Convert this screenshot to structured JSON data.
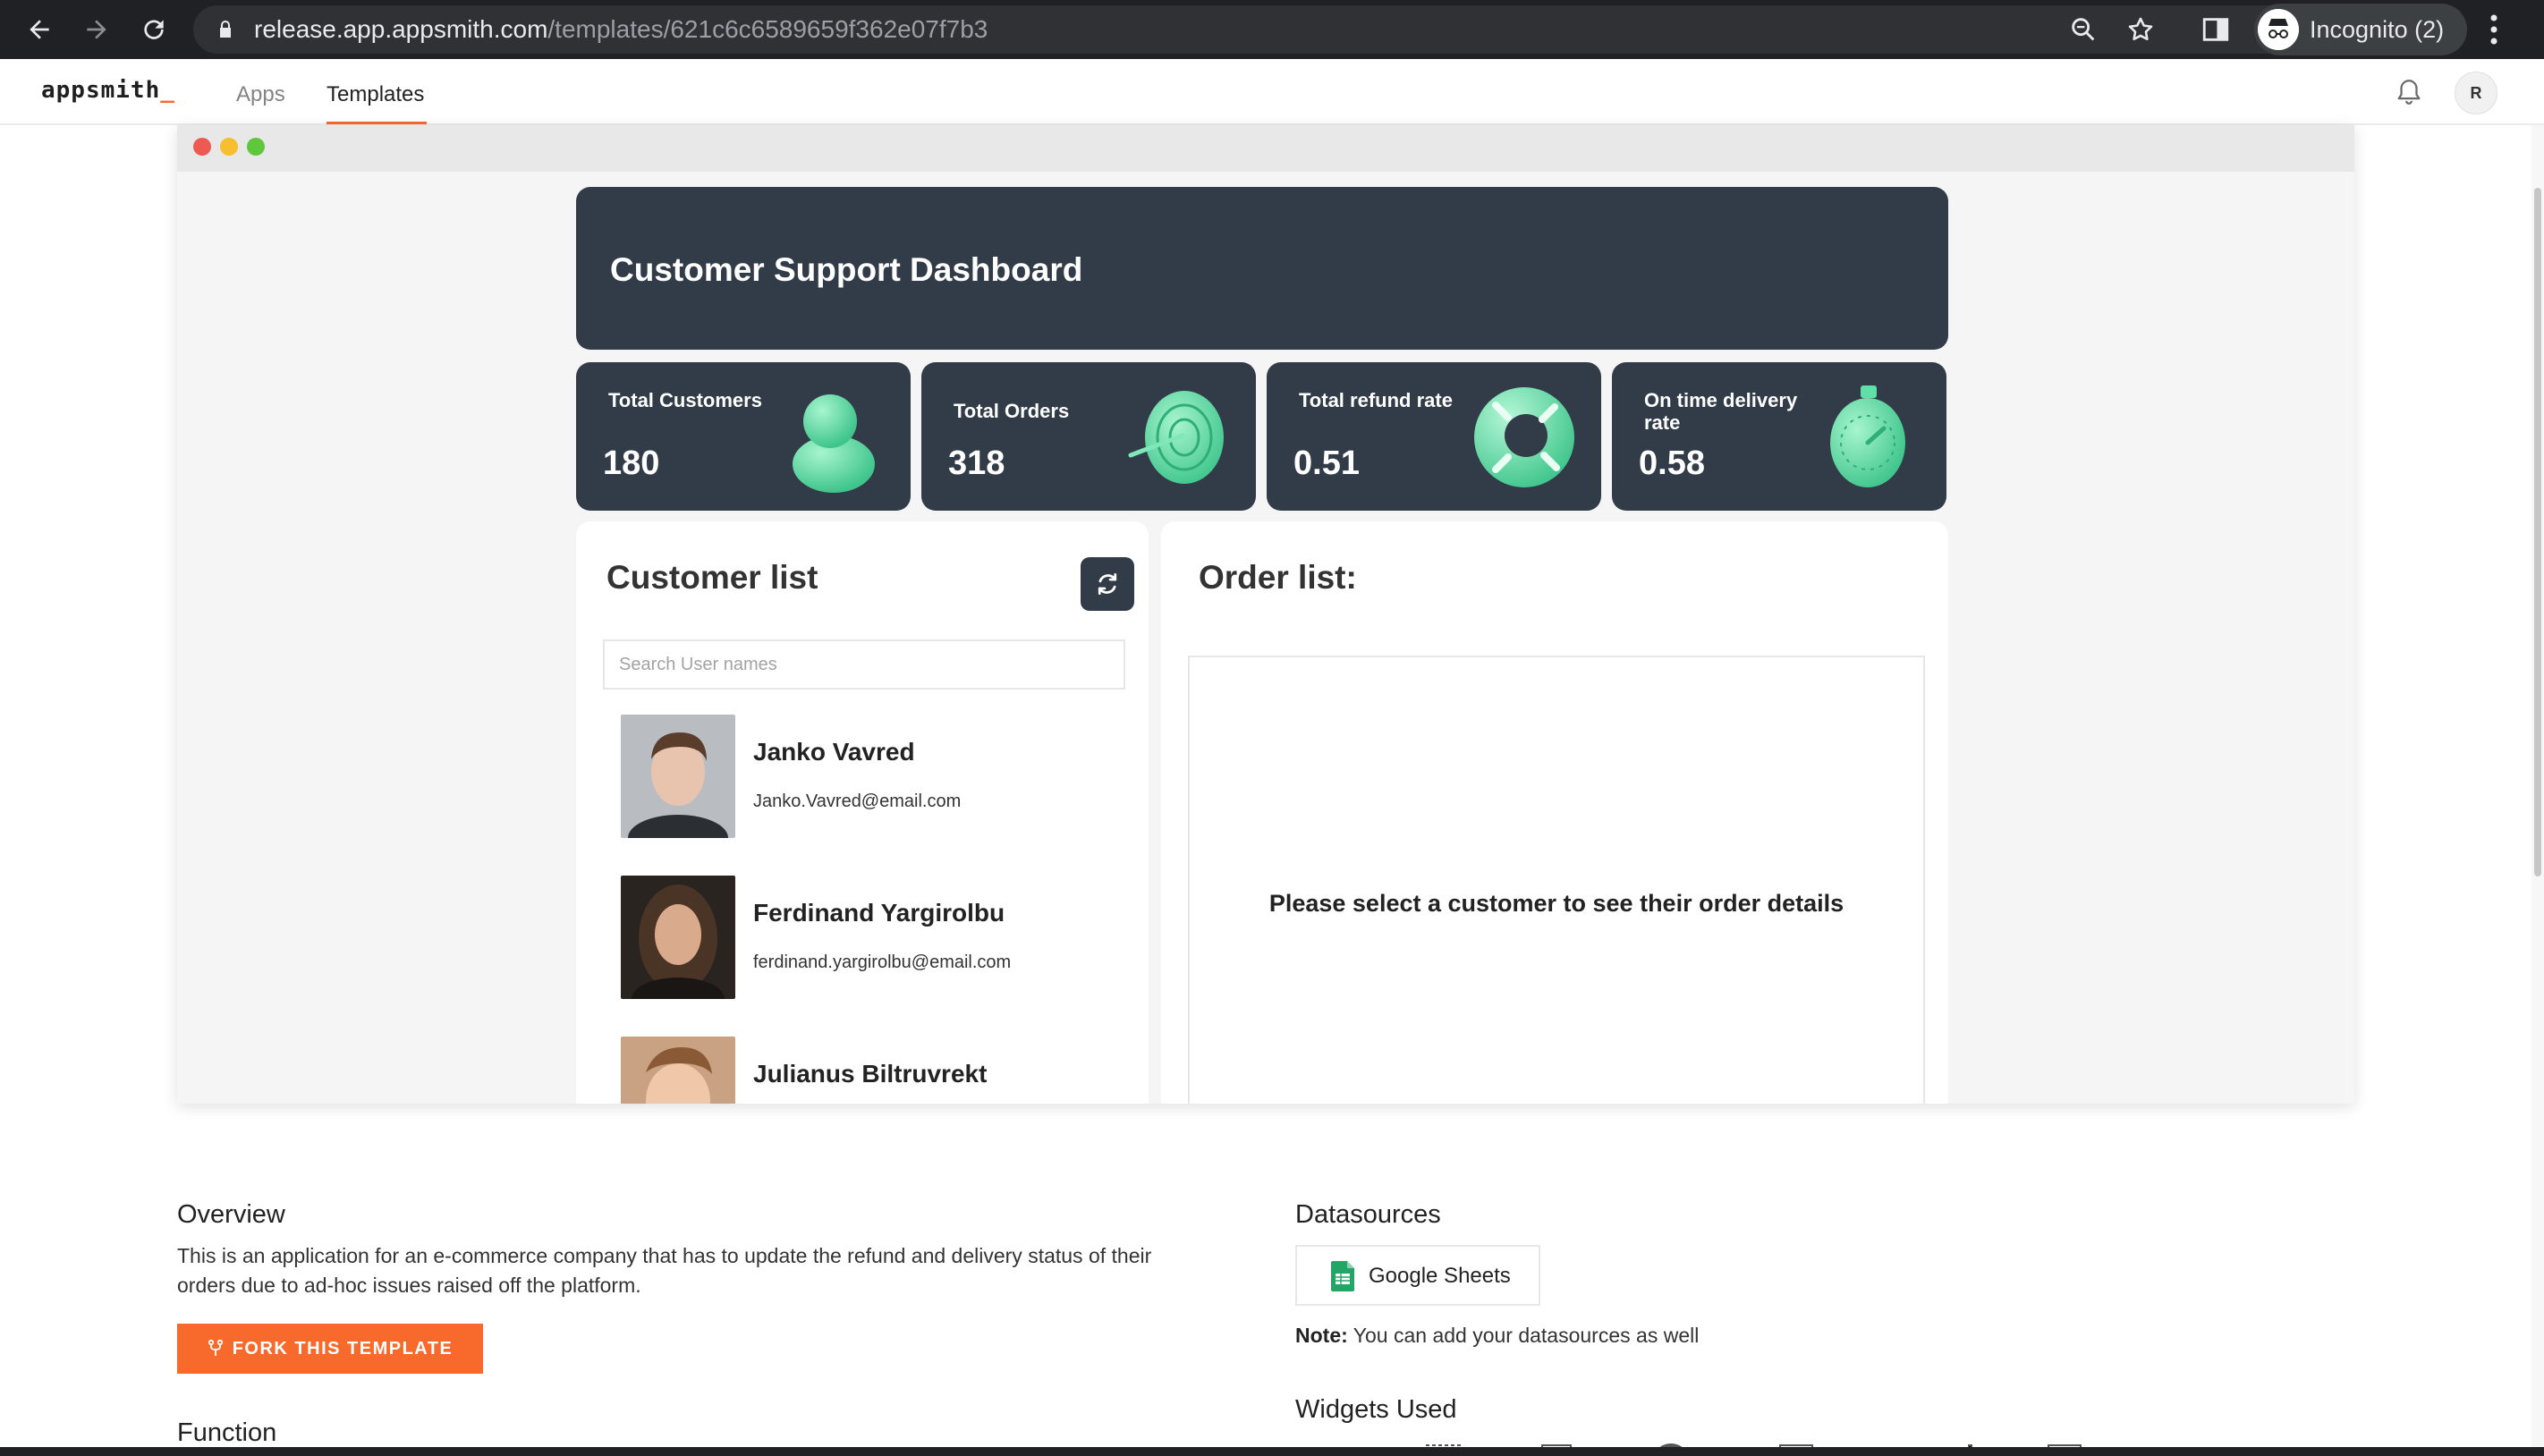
{
  "browser": {
    "url_host": "release.app.appsmith.com",
    "url_path": "/templates/621c6c6589659f362e07f7b3",
    "profile_label": "Incognito (2)"
  },
  "app_header": {
    "logo": "appsmith",
    "logo_suffix": "_",
    "tabs": [
      {
        "label": "Apps",
        "active": false
      },
      {
        "label": "Templates",
        "active": true
      }
    ],
    "avatar_initial": "R"
  },
  "dashboard": {
    "title": "Customer Support Dashboard",
    "stats": [
      {
        "label": "Total Customers",
        "value": "180",
        "icon": "person-3d-icon"
      },
      {
        "label": "Total Orders",
        "value": "318",
        "icon": "target-dart-3d-icon"
      },
      {
        "label": "Total refund rate",
        "value": "0.51",
        "icon": "lifebuoy-3d-icon"
      },
      {
        "label": "On time delivery rate",
        "value": "0.58",
        "icon": "stopwatch-3d-icon"
      }
    ],
    "customer_list": {
      "title": "Customer list",
      "search_placeholder": "Search User names",
      "customers": [
        {
          "name": "Janko Vavred",
          "email": "Janko.Vavred@email.com"
        },
        {
          "name": "Ferdinand Yargirolbu",
          "email": "ferdinand.yargirolbu@email.com"
        },
        {
          "name": "Julianus Biltruvrekt",
          "email": ""
        }
      ]
    },
    "order_list": {
      "title": "Order list:",
      "empty_message": "Please select a customer to see their order details"
    }
  },
  "details": {
    "overview_title": "Overview",
    "overview_text": "This is an application for an e-commerce company that has to update the refund and delivery status of their orders due to ad-hoc issues raised off the platform.",
    "fork_label": "FORK THIS TEMPLATE",
    "function_title": "Function",
    "datasources_title": "Datasources",
    "datasource": "Google Sheets",
    "note_label": "Note:",
    "note_text": "You can add your datasources as well",
    "widgets_title": "Widgets Used"
  },
  "colors": {
    "accent": "#f86a2b",
    "dashboard_dark": "#323c48",
    "icon_mint": "#5fe0a8"
  }
}
